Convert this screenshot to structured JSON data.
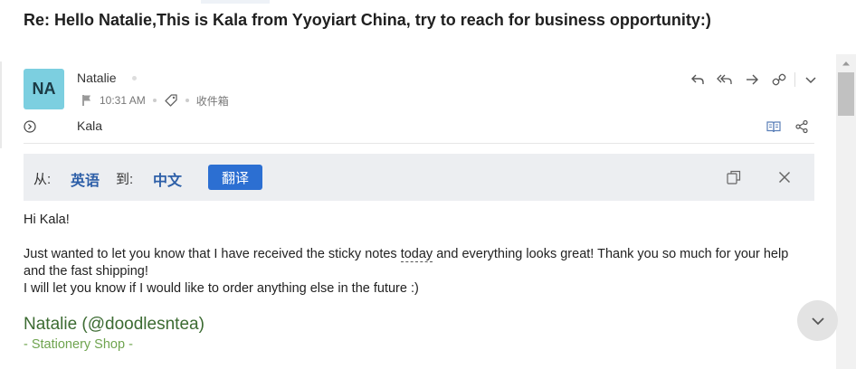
{
  "subject": "Re: Hello Natalie,This is Kala from Yyoyiart China, try to reach for business opportunity:)",
  "sender": {
    "avatar_initials": "NA",
    "avatar_color": "#7ccfe0",
    "name": "Natalie",
    "time": "10:31 AM",
    "folder": "收件箱"
  },
  "recipient": "Kala",
  "translate": {
    "from_label": "从:",
    "from_lang": "英语",
    "to_label": "到:",
    "to_lang": "中文",
    "button": "翻译",
    "accent": "#2c6fd2"
  },
  "body": {
    "greeting": "Hi Kala!",
    "para1_before": "Just wanted to let you know that I have received the sticky notes",
    "para1_link": "today",
    "para1_after": "and everything looks great! Thank you so much for your help and the fast shipping!",
    "para2": "I will let you know if I would like to order anything else in the future :)"
  },
  "signature": {
    "name": "Natalie (@doodlesntea)",
    "shop": "- Stationery Shop -",
    "name_color": "#3c6b32",
    "shop_color": "#6fa44f"
  },
  "icons": {
    "actions": [
      "reply-icon",
      "reply-all-icon",
      "forward-icon",
      "link-icon",
      "chevron-down-icon"
    ],
    "meta": [
      "flag-icon",
      "tag-icon"
    ],
    "small": [
      "book-icon",
      "share-icon"
    ],
    "translate_bar": [
      "copy-icon",
      "close-icon"
    ]
  }
}
